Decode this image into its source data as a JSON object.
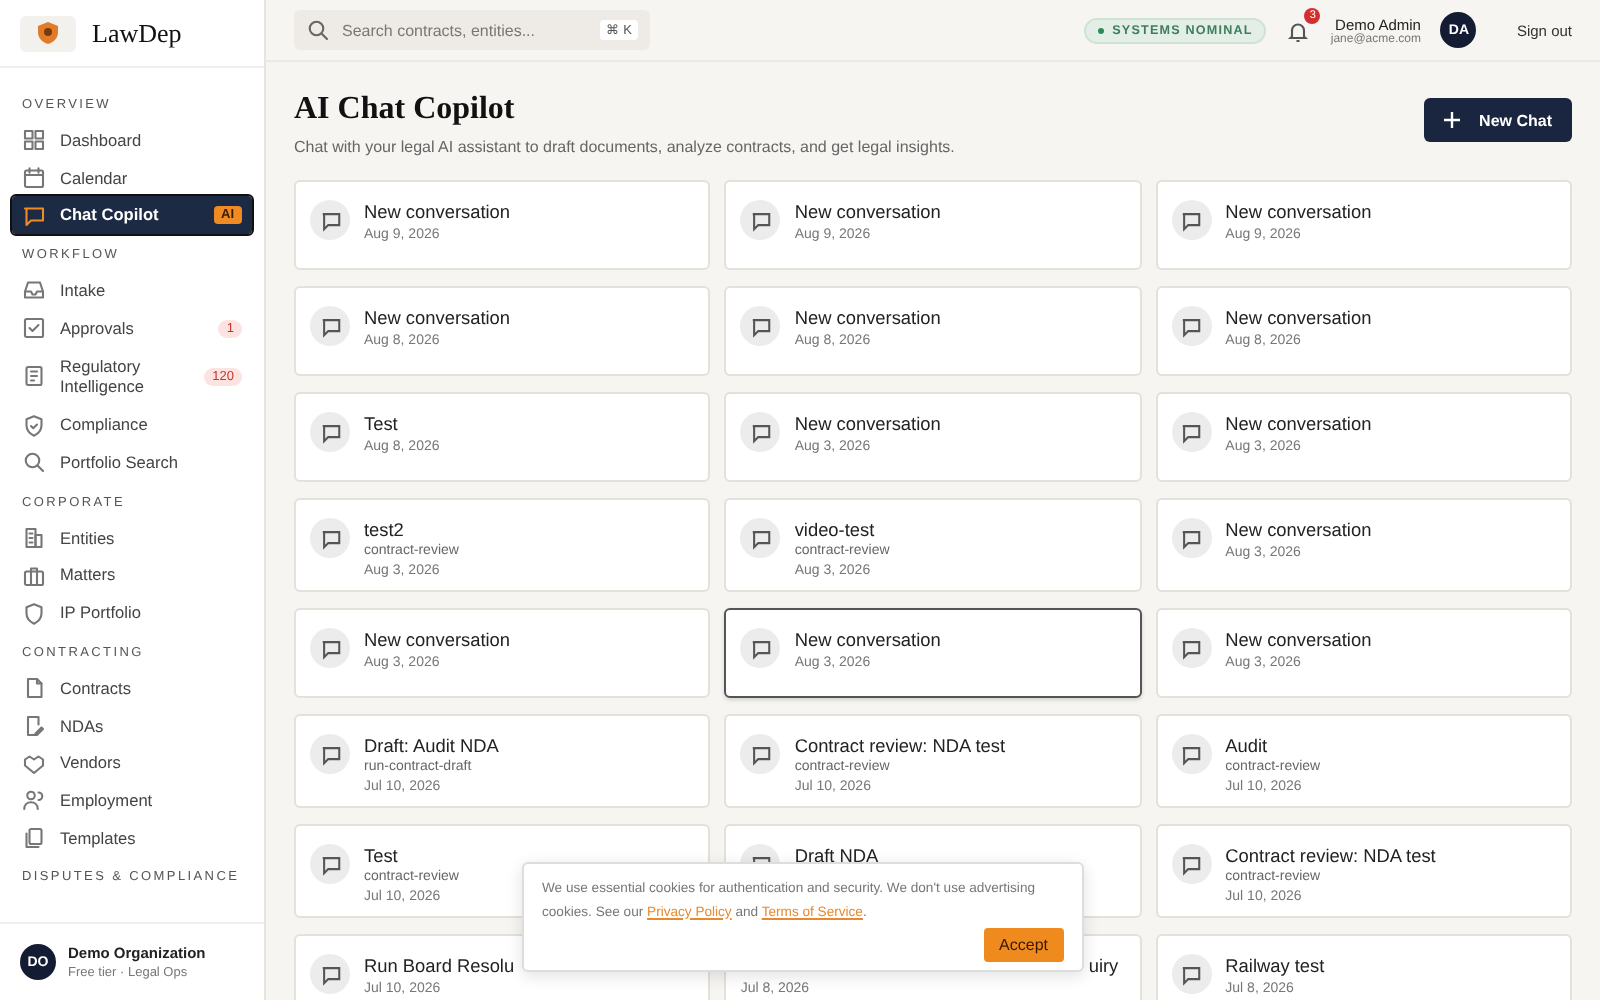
{
  "brand": {
    "name": "LawDep"
  },
  "sidebar": {
    "sections": [
      {
        "title": "OVERVIEW",
        "items": [
          {
            "label": "Dashboard",
            "selected": false
          },
          {
            "label": "Calendar",
            "selected": false
          },
          {
            "label": "Chat Copilot",
            "selected": true,
            "badge": {
              "text": "AI",
              "kind": "accent"
            }
          }
        ]
      },
      {
        "title": "WORKFLOW",
        "items": [
          {
            "label": "Intake",
            "selected": false
          },
          {
            "label": "Approvals",
            "selected": false,
            "badge": {
              "text": "1",
              "kind": "count"
            }
          },
          {
            "label": "Regulatory Intelligence",
            "selected": false,
            "badge": {
              "text": "120",
              "kind": "count"
            }
          },
          {
            "label": "Compliance",
            "selected": false
          },
          {
            "label": "Portfolio Search",
            "selected": false
          }
        ]
      },
      {
        "title": "CORPORATE",
        "items": [
          {
            "label": "Entities",
            "selected": false
          },
          {
            "label": "Matters",
            "selected": false
          },
          {
            "label": "IP Portfolio",
            "selected": false
          }
        ]
      },
      {
        "title": "CONTRACTING",
        "items": [
          {
            "label": "Contracts",
            "selected": false
          },
          {
            "label": "NDAs",
            "selected": false
          },
          {
            "label": "Vendors",
            "selected": false
          },
          {
            "label": "Employment",
            "selected": false
          },
          {
            "label": "Templates",
            "selected": false
          }
        ]
      },
      {
        "title": "DISPUTES & COMPLIANCE"
      }
    ],
    "org": {
      "initials": "DO",
      "name": "Demo Organization",
      "plan": "Free tier · Legal Ops"
    }
  },
  "topbar": {
    "search": {
      "placeholder": "Search contracts, entities...",
      "shortcut": "⌘ K"
    },
    "status": "SYSTEMS NOMINAL",
    "notifications": "3",
    "user": {
      "name": "Demo Admin",
      "email": "jane@acme.com",
      "initials": "DA"
    },
    "sign_out": "Sign out"
  },
  "page": {
    "title": "AI Chat Copilot",
    "subtitle": "Chat with your legal AI assistant to draft documents, analyze contracts, and get legal insights.",
    "new_button": "New Chat"
  },
  "conversations": [
    {
      "title": "New conversation",
      "date": "Aug 9, 2026",
      "selected": false
    },
    {
      "title": "New conversation",
      "date": "Aug 9, 2026",
      "selected": false
    },
    {
      "title": "New conversation",
      "date": "Aug 9, 2026",
      "selected": false
    },
    {
      "title": "New conversation",
      "date": "Aug 8, 2026",
      "selected": false
    },
    {
      "title": "New conversation",
      "date": "Aug 8, 2026",
      "selected": false
    },
    {
      "title": "New conversation",
      "date": "Aug 8, 2026",
      "selected": false
    },
    {
      "title": "Test",
      "date": "Aug 8, 2026",
      "selected": false
    },
    {
      "title": "New conversation",
      "date": "Aug 3, 2026",
      "selected": false
    },
    {
      "title": "New conversation",
      "date": "Aug 3, 2026",
      "selected": false
    },
    {
      "title": "test2",
      "tag": "contract-review",
      "date": "Aug 3, 2026",
      "selected": false
    },
    {
      "title": "video-test",
      "tag": "contract-review",
      "date": "Aug 3, 2026",
      "selected": false
    },
    {
      "title": "New conversation",
      "date": "Aug 3, 2026",
      "selected": false
    },
    {
      "title": "New conversation",
      "date": "Aug 3, 2026",
      "selected": false
    },
    {
      "title": "New conversation",
      "date": "Aug 3, 2026",
      "selected": true
    },
    {
      "title": "New conversation",
      "date": "Aug 3, 2026",
      "selected": false
    },
    {
      "title": "Draft: Audit NDA",
      "tag": "run-contract-draft",
      "date": "Jul 10, 2026",
      "selected": false
    },
    {
      "title": "Contract review: NDA test",
      "tag": "contract-review",
      "date": "Jul 10, 2026",
      "selected": false
    },
    {
      "title": "Audit",
      "tag": "contract-review",
      "date": "Jul 10, 2026",
      "selected": false
    },
    {
      "title": "Test",
      "tag": "contract-review",
      "date": "Jul 10, 2026",
      "selected": false
    },
    {
      "title": "Draft NDA",
      "selected": false,
      "kind": "covered"
    },
    {
      "title": "Contract review: NDA test",
      "tag": "contract-review",
      "date": "Jul 10, 2026",
      "selected": false
    },
    {
      "title": "Run Board Resolu",
      "date": "Jul 10, 2026",
      "selected": false
    },
    {
      "title": "uiry",
      "date": "Jul 8, 2026",
      "selected": false,
      "kind": "tail"
    },
    {
      "title": "Railway test",
      "date": "Jul 8, 2026",
      "selected": false
    }
  ],
  "cookie_banner": {
    "text": "We use essential cookies for authentication and security. We don't use advertising cookies. See our",
    "privacy_link": "Privacy Policy",
    "joiner": "and",
    "terms_link": "Terms of Service",
    "end": ".",
    "accept": "Accept"
  }
}
